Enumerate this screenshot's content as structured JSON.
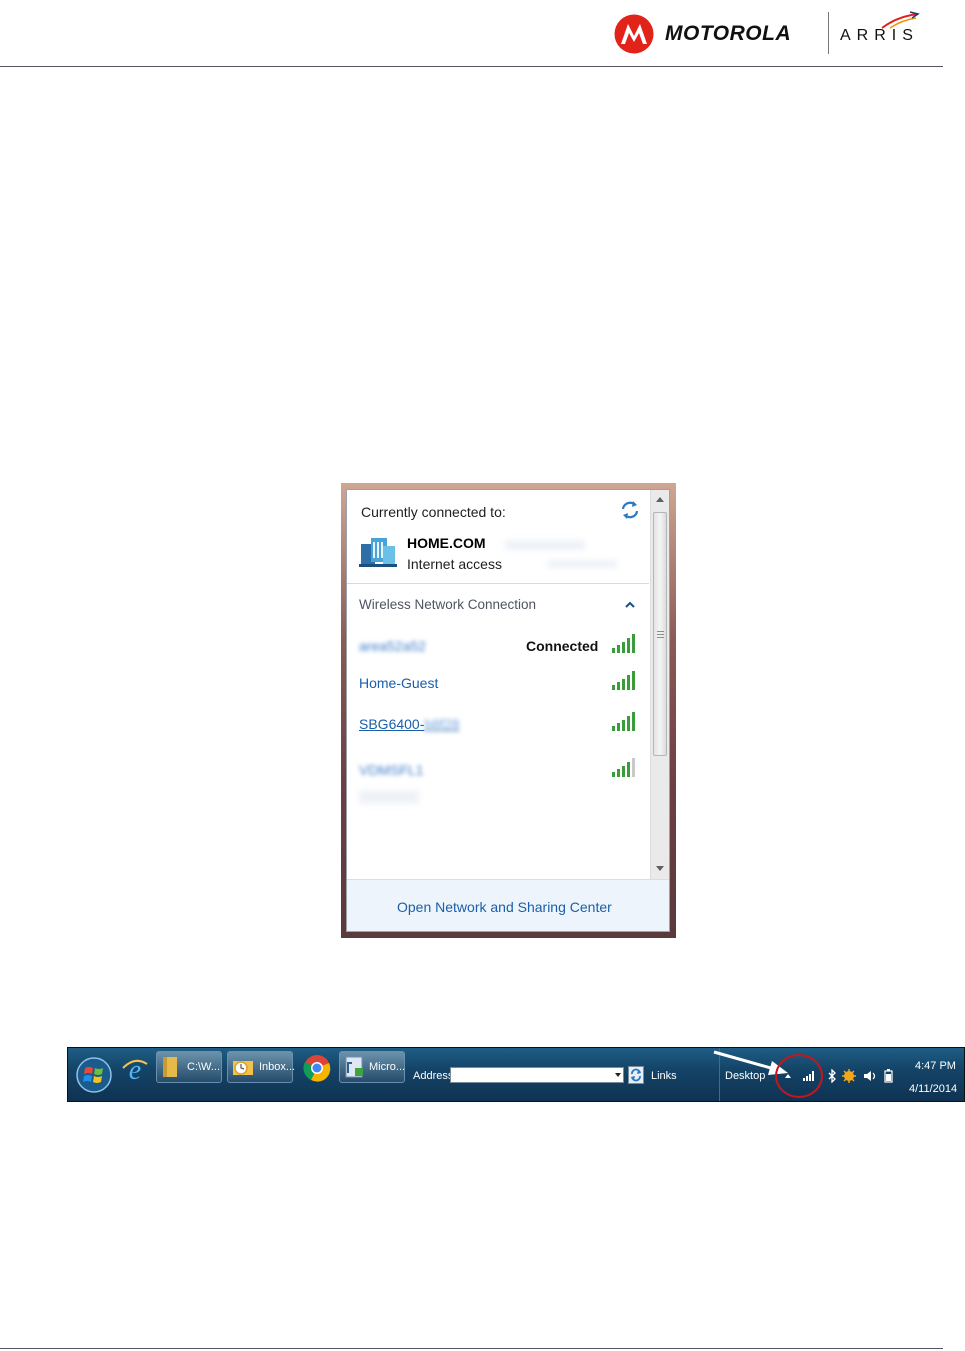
{
  "header": {
    "brand_primary": "MOTOROLA",
    "brand_secondary": "ARRIS",
    "accent_color": "#e2231a"
  },
  "network_popup": {
    "title": "Currently connected to:",
    "current_network": {
      "name": "HOME.COM",
      "status": "Internet access"
    },
    "section_header": "Wireless Network Connection",
    "networks": [
      {
        "name": "area52a52",
        "status": "Connected",
        "signal_bars": 5,
        "signal": "5 of 5",
        "blurred": true
      },
      {
        "name": "Home-Guest",
        "status": "",
        "signal_bars": 5,
        "signal": "5 of 5",
        "blurred": false
      },
      {
        "name": "SBG6400-",
        "name_suffix": "b8f28",
        "status": "",
        "signal_bars": 5,
        "signal": "5 of 5",
        "blurred": false,
        "underlined": true
      },
      {
        "name": "VDMSFL1",
        "status": "",
        "signal_bars": 4,
        "signal": "4 of 5",
        "blurred": true
      }
    ],
    "footer_link": "Open Network and Sharing Center"
  },
  "taskbar": {
    "buttons": [
      {
        "label": "C:\\W..."
      },
      {
        "label": "Inbox..."
      },
      {
        "label": "Micro..."
      }
    ],
    "address_label": "Address",
    "address_value": "",
    "links_label": "Links",
    "desktop_label": "Desktop",
    "clock_time": "4:47 PM",
    "clock_date": "4/11/2014"
  }
}
